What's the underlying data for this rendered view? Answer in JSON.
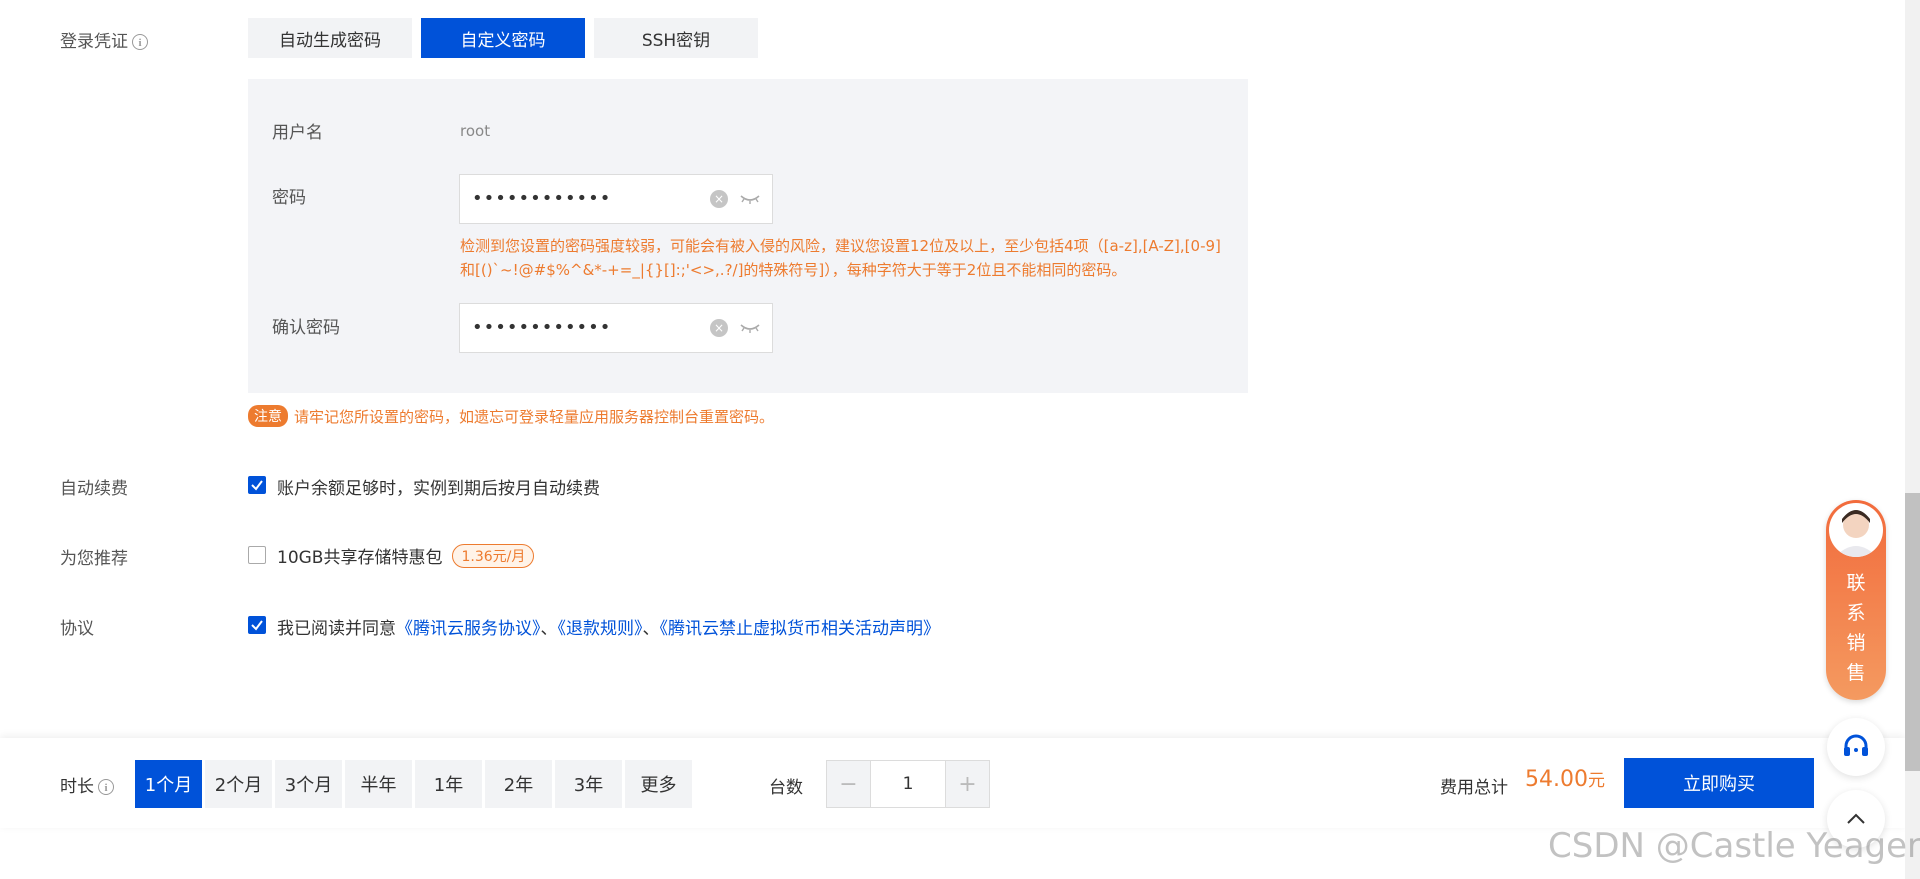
{
  "credentials": {
    "label": "登录凭证",
    "options": [
      "自动生成密码",
      "自定义密码",
      "SSH密钥"
    ],
    "active_index": 1,
    "username_label": "用户名",
    "username_value": "root",
    "password_label": "密码",
    "password_value": "••••••••••••",
    "password_warning_line1": "检测到您设置的密码强度较弱，可能会有被入侵的风险，建议您设置12位及以上，至少包括4项（[a-z],[A-Z],[0-9]",
    "password_warning_line2": "和[()`~!@#$%^&*-+=_|{}[]:;'<>,.?/]的特殊符号]），每种字符大于等于2位且不能相同的密码。",
    "confirm_label": "确认密码",
    "confirm_value": "••••••••••••",
    "notice_badge": "注意",
    "notice_text": "请牢记您所设置的密码，如遗忘可登录轻量应用服务器控制台重置密码。"
  },
  "auto_renew": {
    "label": "自动续费",
    "checked": true,
    "text": "账户余额足够时，实例到期后按月自动续费"
  },
  "recommend": {
    "label": "为您推荐",
    "checked": false,
    "text": "10GB共享存储特惠包",
    "price_badge": "1.36元/月"
  },
  "agreement": {
    "label": "协议",
    "checked": true,
    "prefix": "我已阅读并同意",
    "link1": "《腾讯云服务协议》",
    "sep1": "、",
    "link2": "《退款规则》",
    "sep2": "、",
    "link3": "《腾讯云禁止虚拟货币相关活动声明》"
  },
  "bottom_bar": {
    "duration_label": "时长",
    "durations": [
      "1个月",
      "2个月",
      "3个月",
      "半年",
      "1年",
      "2年",
      "3年",
      "更多"
    ],
    "active_duration_index": 0,
    "quantity_label": "台数",
    "quantity_minus": "−",
    "quantity_value": "1",
    "quantity_plus": "+",
    "total_label": "费用总计",
    "total_amount": "54.00",
    "total_unit": "元",
    "buy_button": "立即购买"
  },
  "side_widget": {
    "contact_sales": [
      "联",
      "系",
      "销",
      "售"
    ]
  },
  "watermark": "CSDN @Castle Yeager",
  "colors": {
    "primary": "#0052d9",
    "warning": "#ed7b2f",
    "panel_bg": "#f3f4f7"
  }
}
